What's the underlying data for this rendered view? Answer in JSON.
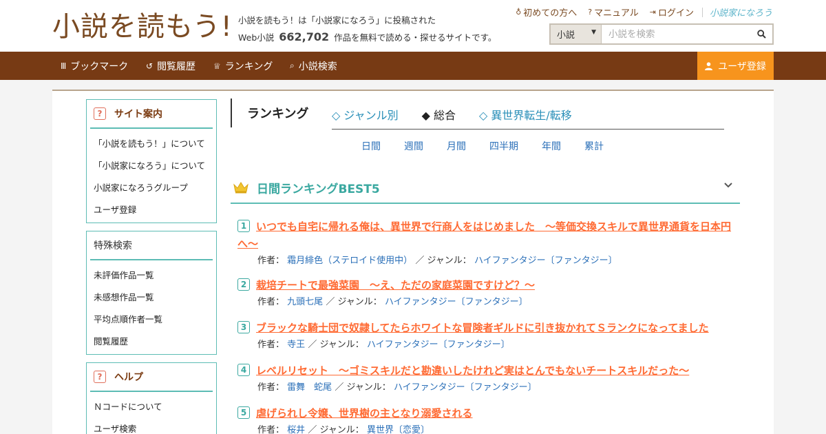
{
  "header": {
    "logo": "小説を読もう!",
    "tagline_line1": "小説を読もう！は「小説家になろう」に投稿された",
    "tagline_prefix": "Web小説",
    "work_count": "662,702",
    "tagline_suffix": "作品を無料で読める・探せるサイトです。",
    "links": [
      {
        "icon": "♁",
        "label": "初めての方へ"
      },
      {
        "icon": "?",
        "label": "マニュアル"
      },
      {
        "icon": "⇥",
        "label": "ログイン"
      }
    ],
    "partner_logo": "小説家になろう",
    "search": {
      "category": "小説",
      "placeholder": "小説を検索"
    }
  },
  "nav": {
    "items": [
      {
        "icon": "Ⅲ",
        "label": "ブックマーク"
      },
      {
        "icon": "↺",
        "label": "閲覧履歴"
      },
      {
        "icon": "♕",
        "label": "ランキング"
      },
      {
        "icon": "⌕",
        "label": "小説検索"
      }
    ],
    "register": "ユーザ登録"
  },
  "sidebar": {
    "guide": {
      "title": "サイト案内",
      "items": [
        "「小説を読もう！」について",
        "「小説家になろう」について",
        "小説家になろうグループ",
        "ユーザ登録"
      ]
    },
    "special": {
      "title": "特殊検索",
      "items": [
        "未評価作品一覧",
        "未感想作品一覧",
        "平均点順作者一覧",
        "閲覧履歴"
      ]
    },
    "help": {
      "title": "ヘルプ",
      "items": [
        "Ｎコードについて",
        "ユーザ検索"
      ]
    }
  },
  "ranking": {
    "title": "ランキング",
    "tabs": [
      {
        "label": "◇ ジャンル別",
        "active": false
      },
      {
        "label": "◆ 総合",
        "active": true
      },
      {
        "label": "◇ 異世界転生/転移",
        "active": false
      }
    ],
    "periods": [
      "日間",
      "週間",
      "月間",
      "四半期",
      "年間",
      "累計"
    ],
    "best_title": "日間ランキングBEST5",
    "author_label": "作者：",
    "genre_label": "／ ジャンル：",
    "items": [
      {
        "rank": "1",
        "title": "いつでも自宅に帰れる俺は、異世界で行商人をはじめました　～等価交換スキルで異世界通貨を日本円へ～",
        "author": "霜月緋色（ステロイド使用中）",
        "genre": "ハイファンタジー〔ファンタジー〕"
      },
      {
        "rank": "2",
        "title": "栽培チートで最強菜園　～え、ただの家庭菜園ですけど？～",
        "author": "九頭七尾",
        "genre": "ハイファンタジー〔ファンタジー〕"
      },
      {
        "rank": "3",
        "title": "ブラックな騎士団で奴隷してたらホワイトな冒険者ギルドに引き抜かれてＳランクになってました",
        "author": "寺王",
        "genre": "ハイファンタジー〔ファンタジー〕"
      },
      {
        "rank": "4",
        "title": "レベルリセット　～ゴミスキルだと勘違いしたけれど実はとんでもないチートスキルだった～",
        "author": "雷舞　蛇尾",
        "genre": "ハイファンタジー〔ファンタジー〕"
      },
      {
        "rank": "5",
        "title": "虐げられし令嬢、世界樹の主となり溺愛される",
        "author": "桜井",
        "genre": "異世界〔恋愛〕"
      }
    ]
  },
  "colors": {
    "brown": "#773a14",
    "orange": "#f7941d",
    "teal": "#5cbcb4",
    "title_orange": "#ff6a33",
    "link_blue": "#2a6fb8"
  }
}
